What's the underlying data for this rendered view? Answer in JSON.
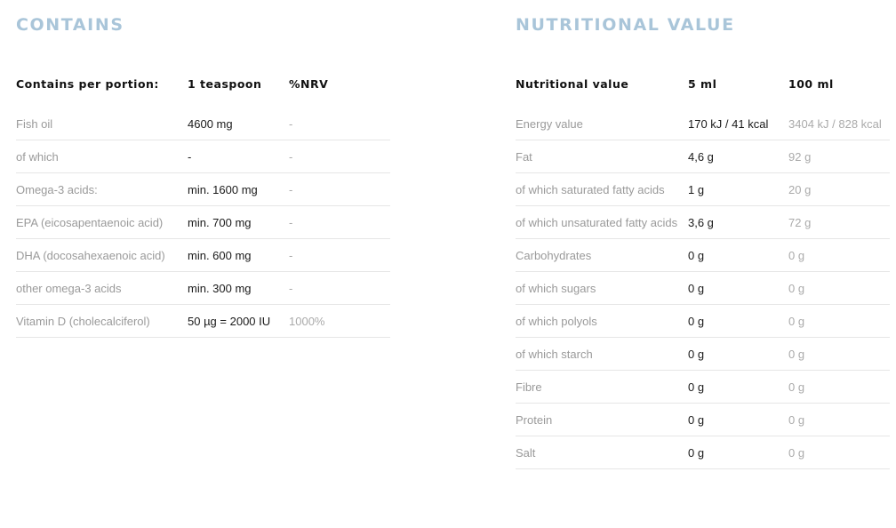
{
  "contains": {
    "title": "CONTAINS",
    "headers": [
      "Contains per portion:",
      "1 teaspoon",
      "%NRV"
    ],
    "rows": [
      [
        "Fish oil",
        "4600 mg",
        "-"
      ],
      [
        "of which",
        "-",
        "-"
      ],
      [
        "Omega-3 acids:",
        "min. 1600 mg",
        "-"
      ],
      [
        "EPA (eicosapentaenoic acid)",
        "min. 700 mg",
        "-"
      ],
      [
        "DHA (docosahexaenoic acid)",
        "min. 600 mg",
        "-"
      ],
      [
        "other omega-3 acids",
        "min. 300 mg",
        "-"
      ],
      [
        "Vitamin D (cholecalciferol)",
        "50 µg = 2000 IU",
        "1000%"
      ]
    ]
  },
  "nutrition": {
    "title": "NUTRITIONAL VALUE",
    "headers": [
      "Nutritional value",
      "5 ml",
      "100 ml"
    ],
    "rows": [
      [
        "Energy value",
        "170 kJ / 41 kcal",
        "3404 kJ / 828 kcal"
      ],
      [
        "Fat",
        "4,6 g",
        "92 g"
      ],
      [
        "of which saturated fatty acids",
        "1 g",
        "20 g"
      ],
      [
        "of which unsaturated fatty acids",
        "3,6 g",
        "72 g"
      ],
      [
        "Carbohydrates",
        "0 g",
        "0 g"
      ],
      [
        "of which sugars",
        "0 g",
        "0 g"
      ],
      [
        "of which polyols",
        "0 g",
        "0 g"
      ],
      [
        "of which starch",
        "0 g",
        "0 g"
      ],
      [
        "Fibre",
        "0 g",
        "0 g"
      ],
      [
        "Protein",
        "0 g",
        "0 g"
      ],
      [
        "Salt",
        "0 g",
        "0 g"
      ]
    ]
  },
  "colors": {
    "heading": "#a9c5d9",
    "label": "#9a9a9a",
    "value": "#1a1a1a",
    "divider": "#e6e6e6"
  }
}
